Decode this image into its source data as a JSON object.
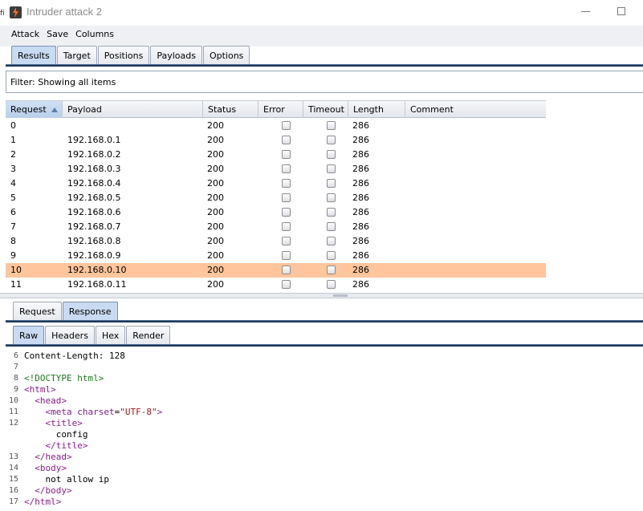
{
  "window": {
    "title": "Intruder attack 2",
    "edge_fragment": "fi"
  },
  "menu": [
    "Attack",
    "Save",
    "Columns"
  ],
  "main_tabs": [
    {
      "label": "Results",
      "active": true
    },
    {
      "label": "Target",
      "active": false
    },
    {
      "label": "Positions",
      "active": false
    },
    {
      "label": "Payloads",
      "active": false
    },
    {
      "label": "Options",
      "active": false
    }
  ],
  "filter": {
    "text": "Filter: Showing all items"
  },
  "table": {
    "columns": [
      "Request",
      "Payload",
      "Status",
      "Error",
      "Timeout",
      "Length",
      "Comment"
    ],
    "sorted_column": "Request",
    "rows": [
      {
        "request": "0",
        "payload": "",
        "status": "200",
        "error": false,
        "timeout": false,
        "length": "286",
        "comment": "",
        "selected": false
      },
      {
        "request": "1",
        "payload": "192.168.0.1",
        "status": "200",
        "error": false,
        "timeout": false,
        "length": "286",
        "comment": "",
        "selected": false
      },
      {
        "request": "2",
        "payload": "192.168.0.2",
        "status": "200",
        "error": false,
        "timeout": false,
        "length": "286",
        "comment": "",
        "selected": false
      },
      {
        "request": "3",
        "payload": "192.168.0.3",
        "status": "200",
        "error": false,
        "timeout": false,
        "length": "286",
        "comment": "",
        "selected": false
      },
      {
        "request": "4",
        "payload": "192.168.0.4",
        "status": "200",
        "error": false,
        "timeout": false,
        "length": "286",
        "comment": "",
        "selected": false
      },
      {
        "request": "5",
        "payload": "192.168.0.5",
        "status": "200",
        "error": false,
        "timeout": false,
        "length": "286",
        "comment": "",
        "selected": false
      },
      {
        "request": "6",
        "payload": "192.168.0.6",
        "status": "200",
        "error": false,
        "timeout": false,
        "length": "286",
        "comment": "",
        "selected": false
      },
      {
        "request": "7",
        "payload": "192.168.0.7",
        "status": "200",
        "error": false,
        "timeout": false,
        "length": "286",
        "comment": "",
        "selected": false
      },
      {
        "request": "8",
        "payload": "192.168.0.8",
        "status": "200",
        "error": false,
        "timeout": false,
        "length": "286",
        "comment": "",
        "selected": false
      },
      {
        "request": "9",
        "payload": "192.168.0.9",
        "status": "200",
        "error": false,
        "timeout": false,
        "length": "286",
        "comment": "",
        "selected": false
      },
      {
        "request": "10",
        "payload": "192.168.0.10",
        "status": "200",
        "error": false,
        "timeout": false,
        "length": "286",
        "comment": "",
        "selected": true
      },
      {
        "request": "11",
        "payload": "192.168.0.11",
        "status": "200",
        "error": false,
        "timeout": false,
        "length": "286",
        "comment": "",
        "selected": false
      }
    ]
  },
  "message_tabs": [
    {
      "label": "Request",
      "active": false
    },
    {
      "label": "Response",
      "active": true
    }
  ],
  "view_tabs": [
    {
      "label": "Raw",
      "active": true
    },
    {
      "label": "Headers",
      "active": false
    },
    {
      "label": "Hex",
      "active": false
    },
    {
      "label": "Render",
      "active": false
    }
  ],
  "response_lines": [
    {
      "n": "6",
      "parts": [
        {
          "t": "Content-Length: 128",
          "c": "plain"
        }
      ]
    },
    {
      "n": "7",
      "parts": []
    },
    {
      "n": "8",
      "parts": [
        {
          "t": "<!DOCTYPE html>",
          "c": "doctype"
        }
      ]
    },
    {
      "n": "9",
      "parts": [
        {
          "t": "<html>",
          "c": "tag"
        }
      ]
    },
    {
      "n": "10",
      "parts": [
        {
          "t": "  <head>",
          "c": "tag"
        }
      ]
    },
    {
      "n": "11",
      "parts": [
        {
          "t": "    <meta ",
          "c": "tag"
        },
        {
          "t": "charset",
          "c": "attrname"
        },
        {
          "t": "=",
          "c": "plain"
        },
        {
          "t": "\"UTF-8\"",
          "c": "attrval"
        },
        {
          "t": ">",
          "c": "tag"
        }
      ]
    },
    {
      "n": "12",
      "parts": [
        {
          "t": "    <title>",
          "c": "tag"
        }
      ]
    },
    {
      "n": "",
      "parts": [
        {
          "t": "      config",
          "c": "plain"
        }
      ]
    },
    {
      "n": "",
      "parts": [
        {
          "t": "    </title>",
          "c": "tag"
        }
      ]
    },
    {
      "n": "13",
      "parts": [
        {
          "t": "  </head>",
          "c": "tag"
        }
      ]
    },
    {
      "n": "14",
      "parts": [
        {
          "t": "  <body>",
          "c": "tag"
        }
      ]
    },
    {
      "n": "15",
      "parts": [
        {
          "t": "    not allow ip",
          "c": "plain"
        }
      ]
    },
    {
      "n": "16",
      "parts": [
        {
          "t": "  </body>",
          "c": "tag"
        }
      ]
    },
    {
      "n": "17",
      "parts": [
        {
          "t": "</html>",
          "c": "tag"
        }
      ]
    }
  ],
  "colors": {
    "selected_row": "#ffc59c",
    "active_tab": "#c9dbf2",
    "tab_underline": "#1f3a5c"
  }
}
